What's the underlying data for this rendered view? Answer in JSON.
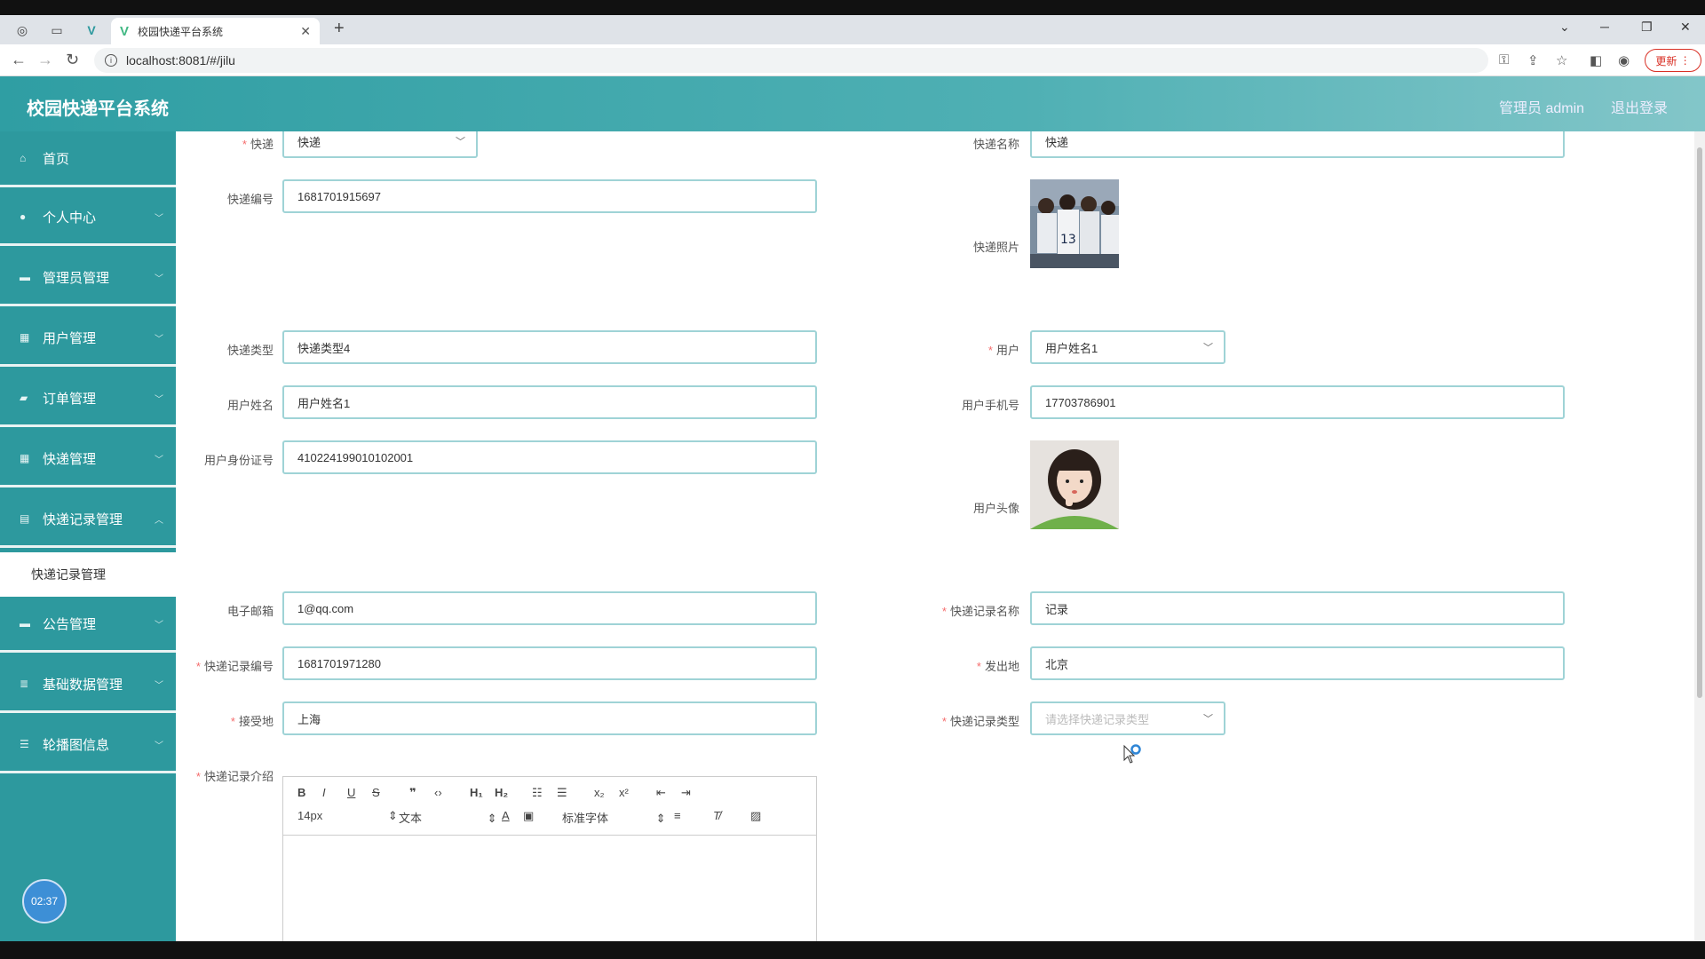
{
  "browser": {
    "tab_title": "校园快递平台系统",
    "url": "localhost:8081/#/jilu",
    "update_label": "更新"
  },
  "header": {
    "title": "校园快递平台系统",
    "admin_label": "管理员 admin",
    "logout_label": "退出登录"
  },
  "sidebar": {
    "items": [
      {
        "label": "首页",
        "icon": "home-icon"
      },
      {
        "label": "个人中心",
        "icon": "user-icon"
      },
      {
        "label": "管理员管理",
        "icon": "chat-icon"
      },
      {
        "label": "用户管理",
        "icon": "grid-icon"
      },
      {
        "label": "订单管理",
        "icon": "briefcase-icon"
      },
      {
        "label": "快递管理",
        "icon": "grid-icon"
      },
      {
        "label": "快递记录管理",
        "icon": "clipboard-icon"
      },
      {
        "label": "公告管理",
        "icon": "chat-icon"
      },
      {
        "label": "基础数据管理",
        "icon": "stack-icon"
      },
      {
        "label": "轮播图信息",
        "icon": "sliders-icon"
      }
    ],
    "submenu_label": "快递记录管理",
    "timer": "02:37"
  },
  "form": {
    "kuaidi_label": "快递",
    "kuaidi_value": "快递",
    "kuaidi_name_label": "快递名称",
    "kuaidi_name_value": "快递",
    "kuaidi_no_label": "快递编号",
    "kuaidi_no_value": "1681701915697",
    "kuaidi_photo_label": "快递照片",
    "kuaidi_type_label": "快递类型",
    "kuaidi_type_value": "快递类型4",
    "user_label": "用户",
    "user_value": "用户姓名1",
    "user_name_label": "用户姓名",
    "user_name_value": "用户姓名1",
    "user_phone_label": "用户手机号",
    "user_phone_value": "17703786901",
    "user_id_label": "用户身份证号",
    "user_id_value": "410224199010102001",
    "user_avatar_label": "用户头像",
    "email_label": "电子邮箱",
    "email_value": "1@qq.com",
    "record_name_label": "快递记录名称",
    "record_name_value": "记录",
    "record_no_label": "快递记录编号",
    "record_no_value": "1681701971280",
    "from_label": "发出地",
    "from_value": "北京",
    "to_label": "接受地",
    "to_value": "上海",
    "record_type_label": "快递记录类型",
    "record_type_placeholder": "请选择快递记录类型",
    "record_intro_label": "快递记录介绍"
  },
  "editor": {
    "font_size": "14px",
    "block_type": "文本",
    "font_family": "标准字体"
  }
}
